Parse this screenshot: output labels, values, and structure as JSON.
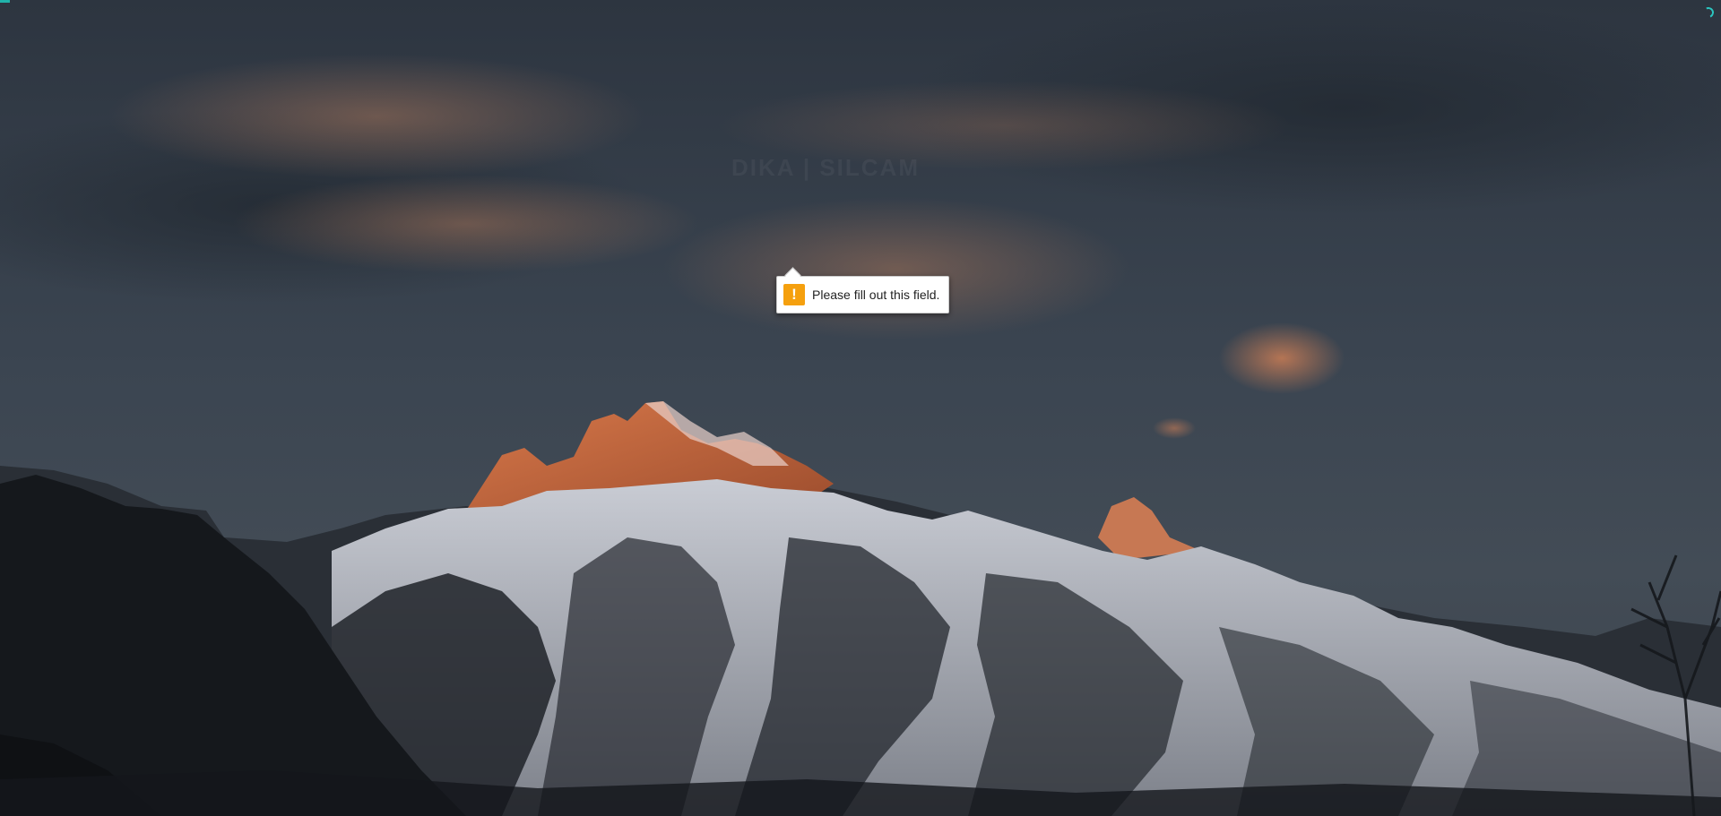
{
  "validation_tooltip": {
    "message": "Please fill out this field.",
    "icon": "warning-icon",
    "icon_glyph": "!",
    "icon_color": "#f5a00e"
  },
  "background": {
    "watermark": "DIKA | SILCAM",
    "accent_color": "#20b2aa"
  }
}
